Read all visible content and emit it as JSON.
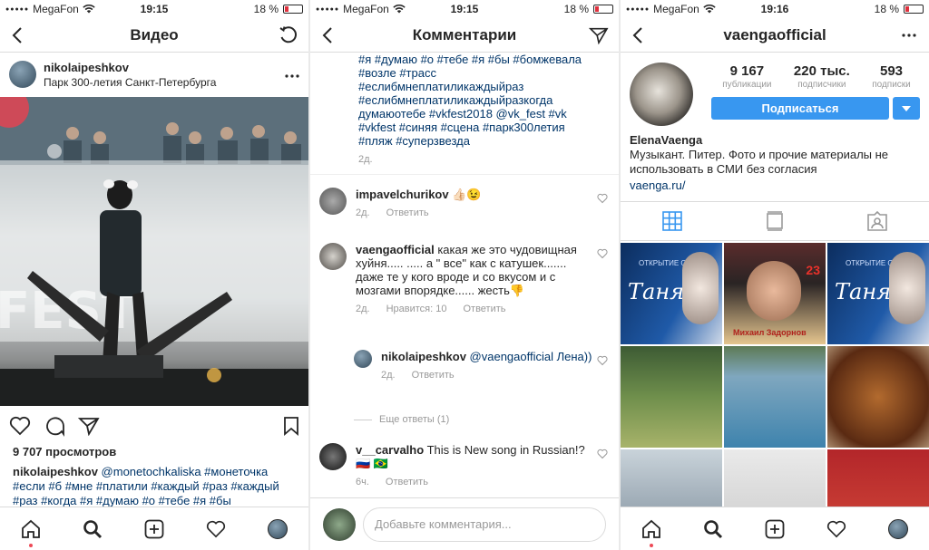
{
  "status": {
    "carrier": "MegaFon",
    "battery": "18 %",
    "time_1": "19:15",
    "time_2": "19:15",
    "time_3": "19:16"
  },
  "video_screen": {
    "title": "Видео",
    "author": "nikolaipeshkov",
    "location": "Парк 300-летия Санкт-Петербурга",
    "views": "9 707 просмотров",
    "caption_user": "nikolaipeshkov",
    "caption_text": "@monetochkaliska #монеточка #если #б #мне #платили #каждый #раз #каждый #раз #когда #я #думаю #о #тебе #я #бы #бомжевала #возле #трасс",
    "stage_text": "FEST"
  },
  "comments_screen": {
    "title": "Комментарии",
    "top_caption": "#я #думаю #о #тебе #я #бы #бомжевала #возле #трасс #еслибмнеплатиликаждыйраз #еслибмнеплатиликаждыйразкогда думаюотебе #vkfest2018 @vk_fest #vk #vkfest #синяя #сцена #парк300летия #пляж #суперзвезда",
    "top_time": "2д.",
    "comments": [
      {
        "user": "impavelchurikov",
        "text": "👍🏻😉",
        "time": "2д.",
        "likes": "",
        "reply": "Ответить"
      },
      {
        "user": "vaengaofficial",
        "text": "какая же это чудовищная хуйня..... ..... а \" все\" как с катушек....... даже те у кого вроде и со вкусом и с мозгами впорядке...... жесть👎",
        "time": "2д.",
        "likes": "Нравится: 10",
        "reply": "Ответить"
      },
      {
        "user": "nikolaipeshkov",
        "text": "@vaengaofficial Лена))",
        "time": "2д.",
        "likes": "",
        "reply": "Ответить"
      },
      {
        "user": "v__carvalho",
        "text": "This is New song in Russian!? 🇷🇺 🇧🇷",
        "time": "6ч.",
        "likes": "",
        "reply": "Ответить"
      }
    ],
    "more_replies": "Еще ответы (1)",
    "input_placeholder": "Добавьте комментария..."
  },
  "profile_screen": {
    "title": "vaengaofficial",
    "posts_count": "9 167",
    "posts_label": "публикации",
    "followers_count": "220 тыс.",
    "followers_label": "подписчики",
    "following_count": "593",
    "following_label": "подписки",
    "follow_button": "Подписаться",
    "name": "ElenaVaenga",
    "bio": "Музыкант. Питер. Фото и прочие материалы не использовать в СМИ без согласия",
    "link": "vaenga.ru/",
    "grid_texts": {
      "poster1_top": "ОТКРЫТИЕ СЕЗОНА",
      "poster1_title": "Таня",
      "poster2_num": "23",
      "poster2_name": "Михаил Задорнов"
    }
  },
  "icons": [
    "back-icon",
    "refresh-icon",
    "more-icon",
    "heart-icon",
    "comment-icon",
    "share-icon",
    "bookmark-icon",
    "home-icon",
    "search-icon",
    "add-icon",
    "profile-tab-icon",
    "send-icon",
    "grid-icon",
    "feed-icon",
    "tagged-icon",
    "wifi-icon",
    "battery-icon"
  ],
  "colors": {
    "accent": "#3897f0",
    "hashtag": "#003569",
    "notification": "#ed4956"
  }
}
